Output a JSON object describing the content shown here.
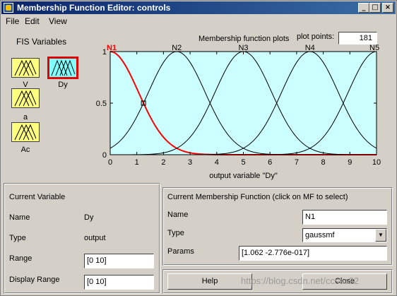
{
  "window": {
    "title": "Membership Function Editor: controls"
  },
  "menu": [
    {
      "label": "File"
    },
    {
      "label": "Edit"
    },
    {
      "label": "View"
    }
  ],
  "fis": {
    "heading": "FIS Variables",
    "variables": [
      {
        "name": "V"
      },
      {
        "name": "Dy"
      },
      {
        "name": "a"
      },
      {
        "name": "Ac"
      }
    ],
    "selected": "Dy"
  },
  "plot": {
    "title": "Membership function plots",
    "plot_points_label": "plot points:",
    "plot_points_value": "181",
    "xlabel": "output variable \"Dy\"",
    "xlim": [
      0,
      10
    ],
    "ylim": [
      0,
      1
    ],
    "x_ticks": [
      "0",
      "1",
      "2",
      "3",
      "4",
      "5",
      "6",
      "7",
      "8",
      "9",
      "10"
    ],
    "y_ticks": [
      "0",
      "0.5",
      "1"
    ],
    "bg_color": "#ccffff",
    "highlight_color": "#ff0000",
    "mfs": [
      {
        "name": "N1",
        "type": "gaussmf",
        "sigma": 1.062,
        "center": 0,
        "selected": true
      },
      {
        "name": "N2",
        "type": "gaussmf",
        "sigma": 1.062,
        "center": 2.5
      },
      {
        "name": "N3",
        "type": "gaussmf",
        "sigma": 1.062,
        "center": 5
      },
      {
        "name": "N4",
        "type": "gaussmf",
        "sigma": 1.062,
        "center": 7.5
      },
      {
        "name": "N5",
        "type": "gaussmf",
        "sigma": 1.062,
        "center": 10
      }
    ],
    "marker_x": 1.25
  },
  "current_variable": {
    "heading": "Current Variable",
    "name_label": "Name",
    "name_value": "Dy",
    "type_label": "Type",
    "type_value": "output",
    "range_label": "Range",
    "range_value": "[0 10]",
    "display_range_label": "Display Range",
    "display_range_value": "[0 10]"
  },
  "current_mf": {
    "heading": "Current Membership Function (click on MF to select)",
    "name_label": "Name",
    "name_value": "N1",
    "type_label": "Type",
    "type_value": "gaussmf",
    "params_label": "Params",
    "params_value": "[1.062 -2.776e-017]"
  },
  "buttons": {
    "help": "Help",
    "close": "Close"
  },
  "watermark": "https://blog.csdn.net/ccsss22"
}
